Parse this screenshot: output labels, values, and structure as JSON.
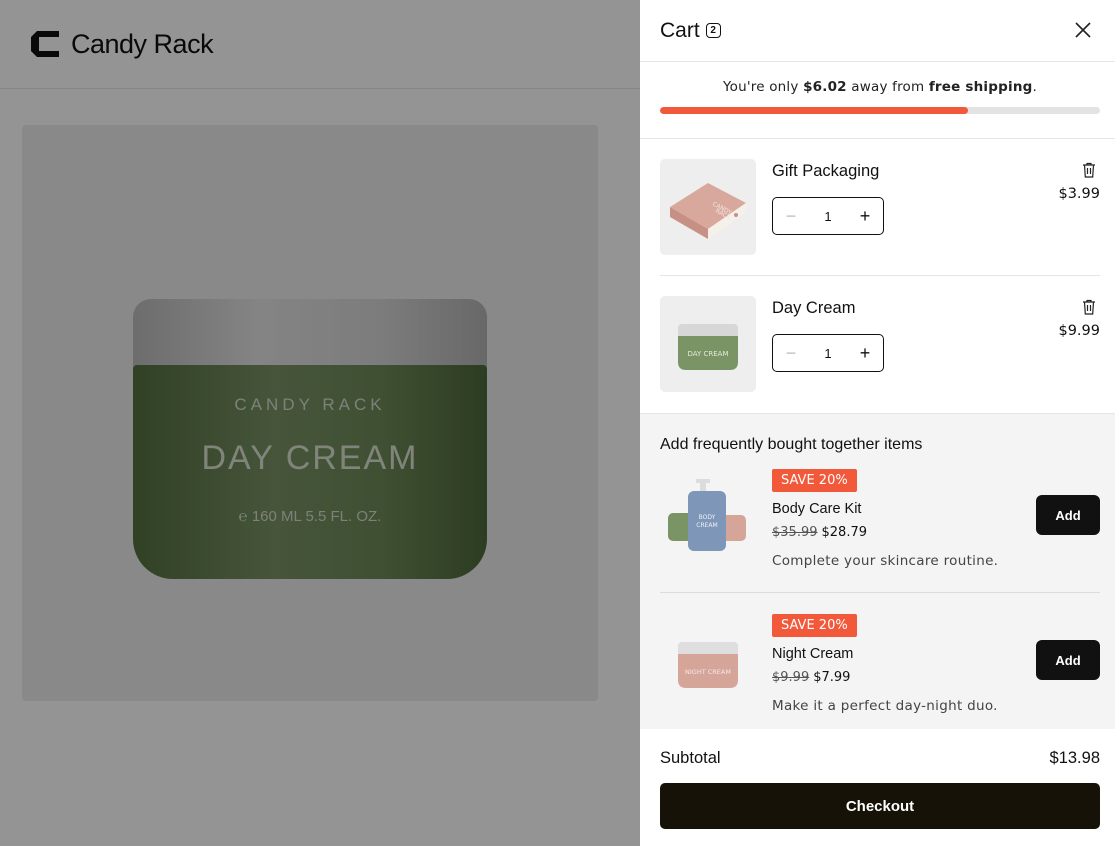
{
  "store": {
    "brand": "Candy Rack",
    "product_image": {
      "brand_label": "CANDY RACK",
      "product_label": "DAY CREAM",
      "size_label": "℮ 160 ML 5.5 FL. OZ."
    }
  },
  "cart": {
    "title": "Cart",
    "count": "2",
    "shipping": {
      "prefix": "You're only ",
      "amount": "$6.02",
      "middle": " away from ",
      "goal": "free shipping",
      "suffix": ".",
      "progress_fraction": 0.7
    },
    "items": [
      {
        "title": "Gift Packaging",
        "quantity": "1",
        "price": "$3.99",
        "image_icon": "gift-box-image"
      },
      {
        "title": "Day Cream",
        "quantity": "1",
        "price": "$9.99",
        "image_icon": "day-cream-jar-image"
      }
    ],
    "upsell": {
      "title": "Add frequently bought together items",
      "items": [
        {
          "badge": "SAVE 20%",
          "name": "Body Care Kit",
          "old_price": "$35.99",
          "price": "$28.79",
          "description": "Complete your skincare routine.",
          "button": "Add"
        },
        {
          "badge": "SAVE 20%",
          "name": "Night Cream",
          "old_price": "$9.99",
          "price": "$7.99",
          "description": "Make it a perfect day-night duo.",
          "button": "Add"
        }
      ]
    },
    "subtotal_label": "Subtotal",
    "subtotal_value": "$13.98",
    "checkout_label": "Checkout"
  },
  "colors": {
    "accent": "#f2593a",
    "checkout": "#161208",
    "overlay": "rgba(0,0,0,0.42)"
  }
}
